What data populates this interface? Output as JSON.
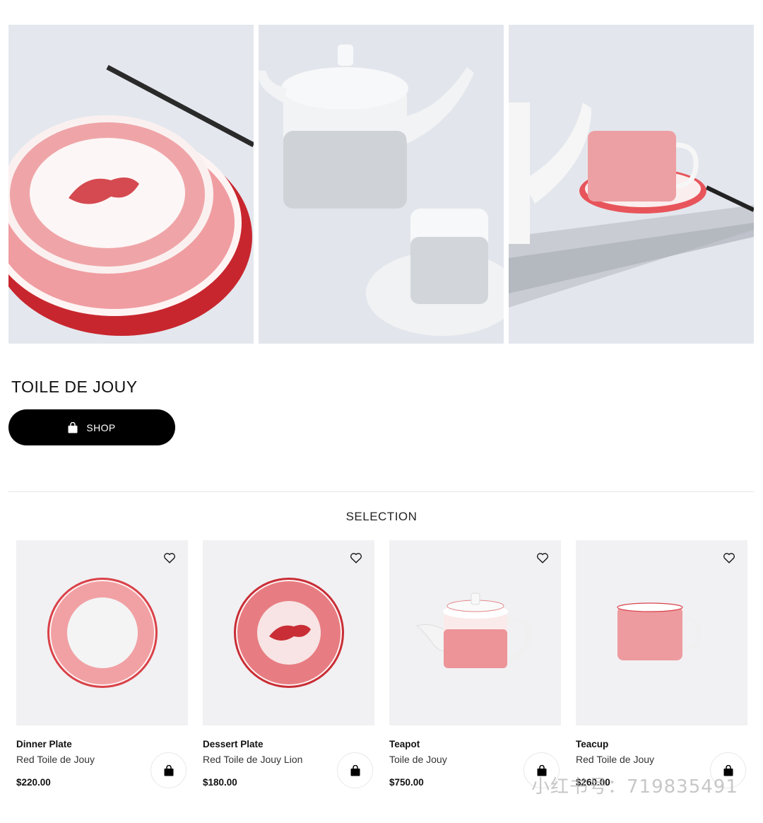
{
  "hero": {
    "images": [
      "plates-photo",
      "teapot-cup-photo",
      "tray-teacup-photo"
    ]
  },
  "collection": {
    "title": "TOILE DE JOUY",
    "shop_label": "SHOP"
  },
  "selection": {
    "heading": "SELECTION",
    "products": [
      {
        "name": "Dinner Plate",
        "subtitle": "Red Toile de Jouy",
        "price": "$220.00",
        "icon": "dinner-plate"
      },
      {
        "name": "Dessert Plate",
        "subtitle": "Red Toile de Jouy Lion",
        "price": "$180.00",
        "icon": "dessert-plate"
      },
      {
        "name": "Teapot",
        "subtitle": "Toile de Jouy",
        "price": "$750.00",
        "icon": "teapot"
      },
      {
        "name": "Teacup",
        "subtitle": "Red Toile de Jouy",
        "price": "$260.00",
        "icon": "teacup"
      }
    ]
  },
  "watermark": "小红书号：719835491",
  "colors": {
    "accent_red": "#d43a3f",
    "button_black": "#000000",
    "card_bg": "#f1f1f3"
  }
}
